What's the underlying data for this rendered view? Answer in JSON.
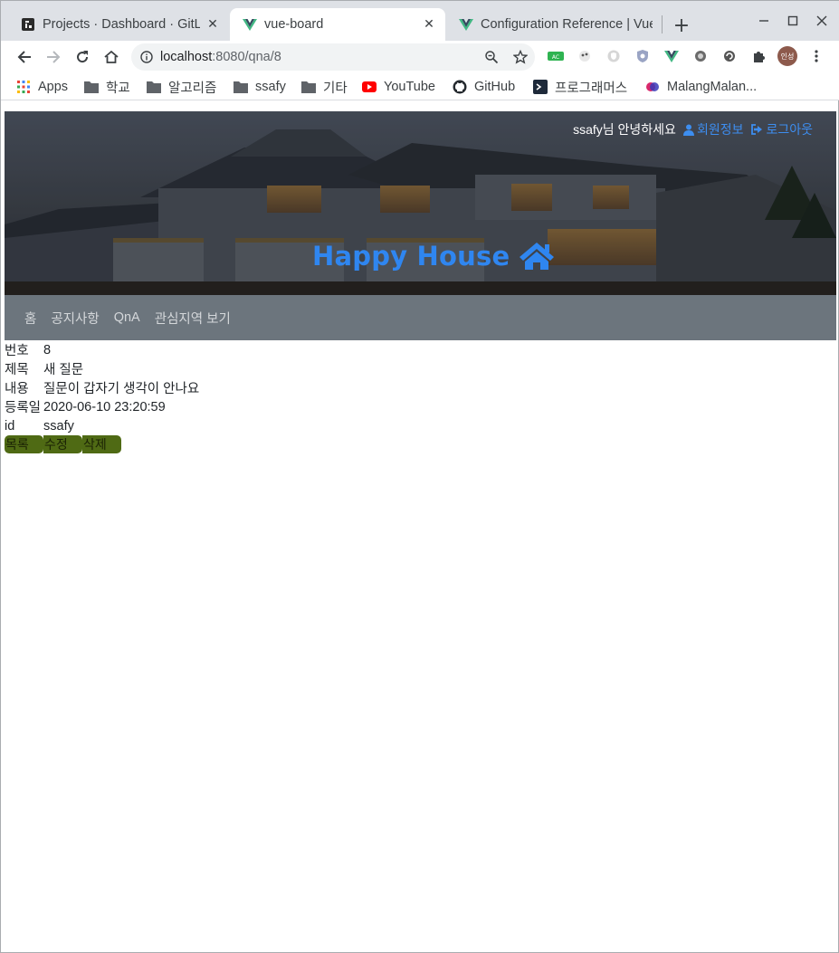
{
  "browser": {
    "tabs": [
      {
        "title": "Projects · Dashboard · GitLab",
        "icon": "gitlab-icon",
        "active": false
      },
      {
        "title": "vue-board",
        "icon": "vue-icon",
        "active": true
      },
      {
        "title": "Configuration Reference | Vue CLI",
        "icon": "vue-icon",
        "active": false
      }
    ],
    "url_host": "localhost",
    "url_rest": ":8080/qna/8",
    "profile_initials": "인성"
  },
  "bookmarks": [
    {
      "label": "Apps",
      "icon": "apps-grid-icon"
    },
    {
      "label": "학교",
      "icon": "folder-icon"
    },
    {
      "label": "알고리즘",
      "icon": "folder-icon"
    },
    {
      "label": "ssafy",
      "icon": "folder-icon"
    },
    {
      "label": "기타",
      "icon": "folder-icon"
    },
    {
      "label": "YouTube",
      "icon": "youtube-icon"
    },
    {
      "label": "GitHub",
      "icon": "github-icon"
    },
    {
      "label": "프로그래머스",
      "icon": "programmers-icon"
    },
    {
      "label": "MalangMalan...",
      "icon": "malang-icon"
    }
  ],
  "header": {
    "greeting": "ssafy님 안녕하세요",
    "member_info": "회원정보",
    "logout": "로그아웃",
    "brand": "Happy House"
  },
  "nav": {
    "items": [
      "홈",
      "공지사항",
      "QnA",
      "관심지역 보기"
    ]
  },
  "qna": {
    "rows": [
      {
        "label": "번호",
        "value": "8"
      },
      {
        "label": "제목",
        "value": "새 질문"
      },
      {
        "label": "내용",
        "value": "질문이 갑자기 생각이 안나요"
      },
      {
        "label": "등록일",
        "value": "2020-06-10 23:20:59"
      },
      {
        "label": "id",
        "value": "ssafy"
      }
    ],
    "buttons": {
      "list": "목록",
      "edit": "수정",
      "delete": "삭제"
    }
  },
  "colors": {
    "brand": "#2f86f0",
    "nav_bg": "#6c757d",
    "button_bg": "#4f6a14"
  }
}
